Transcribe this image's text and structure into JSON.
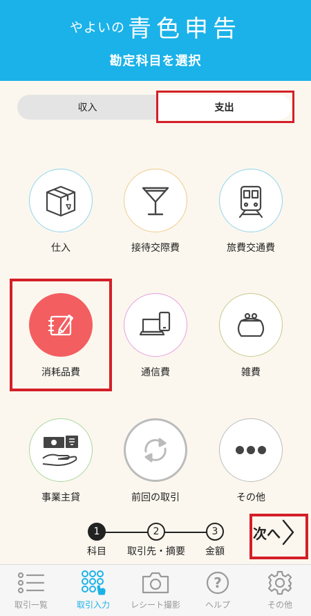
{
  "header": {
    "brand_small": "やよいの",
    "brand_big": "青色申告",
    "subtitle": "勘定科目を選択"
  },
  "segment": {
    "income": "収入",
    "expense": "支出",
    "selected": "支出"
  },
  "categories": [
    {
      "label": "仕入",
      "icon": "box-icon",
      "color": "#8fd4ec"
    },
    {
      "label": "接待交際費",
      "icon": "cocktail-glass-icon",
      "color": "#f2c98b"
    },
    {
      "label": "旅費交通費",
      "icon": "train-icon",
      "color": "#8fd4ec"
    },
    {
      "label": "消耗品費",
      "icon": "notebook-pen-icon",
      "color": "#f35e60",
      "selected": true
    },
    {
      "label": "通信費",
      "icon": "laptop-phone-icon",
      "color": "#e79de0"
    },
    {
      "label": "雑費",
      "icon": "coin-purse-icon",
      "color": "#c5c98a"
    },
    {
      "label": "事業主貸",
      "icon": "money-hand-icon",
      "color": "#a8d69a"
    },
    {
      "label": "前回の取引",
      "icon": "refresh-icon",
      "color": "#cccccc"
    },
    {
      "label": "その他",
      "icon": "more-dots-icon",
      "color": "#cccccc"
    }
  ],
  "steps": [
    {
      "number": "1",
      "label": "科目",
      "active": true
    },
    {
      "number": "2",
      "label": "取引先・摘要"
    },
    {
      "number": "3",
      "label": "金額"
    }
  ],
  "next": {
    "label": "次へ"
  },
  "tabbar": [
    {
      "label": "取引一覧",
      "icon": "list-icon"
    },
    {
      "label": "取引入力",
      "icon": "keypad-icon",
      "active": true
    },
    {
      "label": "レシート撮影",
      "icon": "camera-icon"
    },
    {
      "label": "ヘルプ",
      "icon": "help-icon"
    },
    {
      "label": "その他",
      "icon": "gear-icon"
    }
  ],
  "colors": {
    "header_bg": "#1ab2e8",
    "highlight": "#d31f27",
    "background": "#fbf7ee"
  }
}
